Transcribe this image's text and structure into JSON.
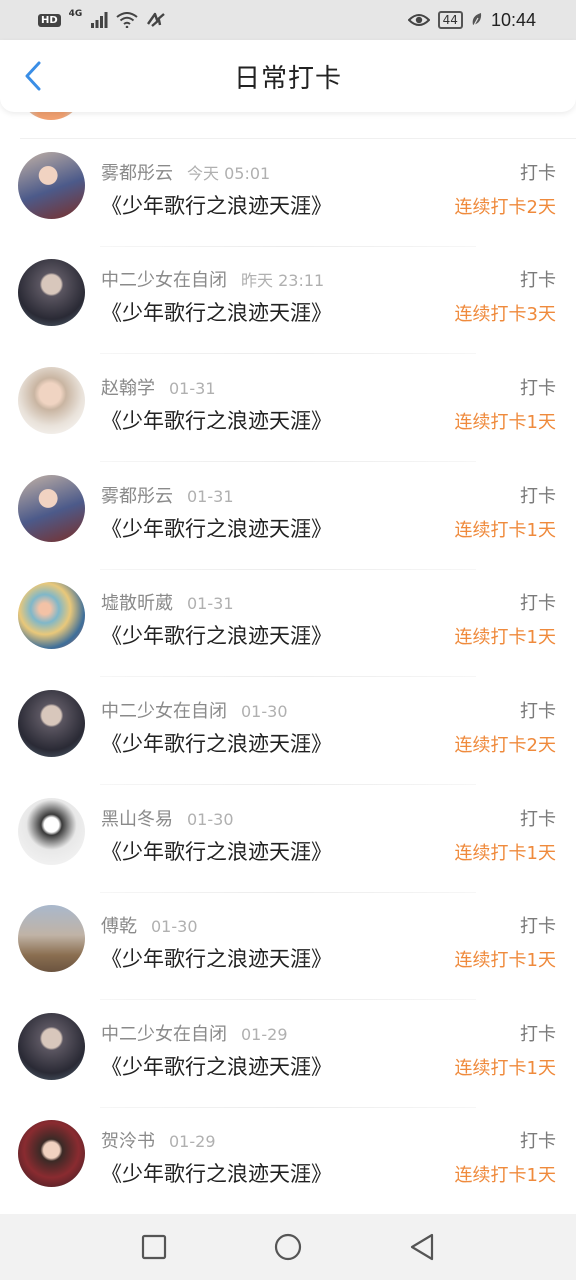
{
  "status_bar": {
    "left_label": "HD",
    "network": "4G",
    "battery": "44",
    "time": "10:44",
    "icons": [
      "signal-icon",
      "wifi-icon",
      "nfc-icon",
      "eye-icon",
      "battery-icon",
      "leaf-icon"
    ]
  },
  "header": {
    "title": "日常打卡",
    "back_icon": "chevron-left-icon",
    "accent_color": "#3a8ee6"
  },
  "entries": [
    {
      "name": "雾都彤云",
      "time": "今天 05:01",
      "book": "《少年歌行之浪迹天涯》",
      "action": "打卡",
      "streak": "连续打卡2天",
      "avatar": "avatar-photo"
    },
    {
      "name": "中二少女在自闭",
      "time": "昨天 23:11",
      "book": "《少年歌行之浪迹天涯》",
      "action": "打卡",
      "streak": "连续打卡3天",
      "avatar": "avatar-photo"
    },
    {
      "name": "赵翰学",
      "time": "01-31",
      "book": "《少年歌行之浪迹天涯》",
      "action": "打卡",
      "streak": "连续打卡1天",
      "avatar": "avatar-photo"
    },
    {
      "name": "雾都彤云",
      "time": "01-31",
      "book": "《少年歌行之浪迹天涯》",
      "action": "打卡",
      "streak": "连续打卡1天",
      "avatar": "avatar-photo"
    },
    {
      "name": "墟散昕葳",
      "time": "01-31",
      "book": "《少年歌行之浪迹天涯》",
      "action": "打卡",
      "streak": "连续打卡1天",
      "avatar": "avatar-photo"
    },
    {
      "name": "中二少女在自闭",
      "time": "01-30",
      "book": "《少年歌行之浪迹天涯》",
      "action": "打卡",
      "streak": "连续打卡2天",
      "avatar": "avatar-photo"
    },
    {
      "name": "黑山冬易",
      "time": "01-30",
      "book": "《少年歌行之浪迹天涯》",
      "action": "打卡",
      "streak": "连续打卡1天",
      "avatar": "avatar-photo"
    },
    {
      "name": "傅乾",
      "time": "01-30",
      "book": "《少年歌行之浪迹天涯》",
      "action": "打卡",
      "streak": "连续打卡1天",
      "avatar": "avatar-photo"
    },
    {
      "name": "中二少女在自闭",
      "time": "01-29",
      "book": "《少年歌行之浪迹天涯》",
      "action": "打卡",
      "streak": "连续打卡1天",
      "avatar": "avatar-photo"
    },
    {
      "name": "贺泠书",
      "time": "01-29",
      "book": "《少年歌行之浪迹天涯》",
      "action": "打卡",
      "streak": "连续打卡1天",
      "avatar": "avatar-photo"
    }
  ],
  "streak_color": "#ef8a3c",
  "nav_bar": {
    "icons": [
      "recent-apps-icon",
      "home-icon",
      "back-triangle-icon"
    ]
  }
}
